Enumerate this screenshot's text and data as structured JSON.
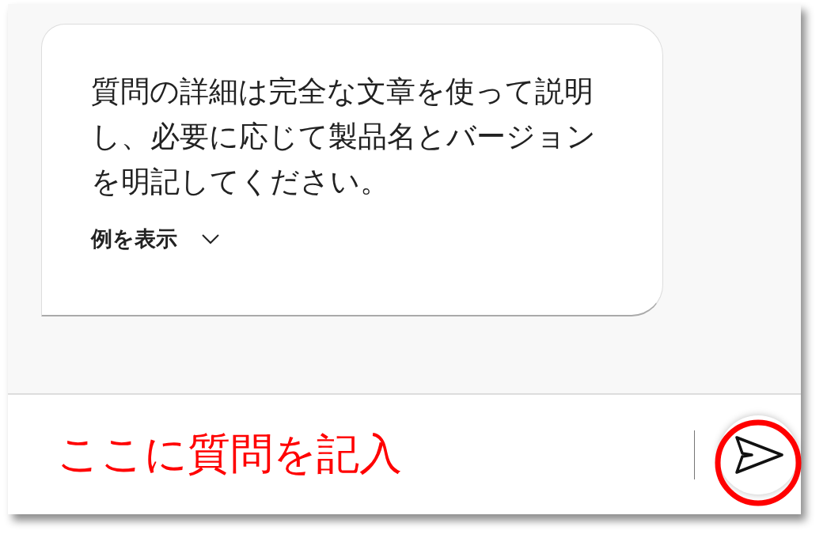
{
  "message": {
    "text": "質問の詳細は完全な文章を使って説明し、必要に応じて製品名とバージョンを明記してください。",
    "toggle": {
      "label": "例を表示",
      "expanded": false
    }
  },
  "composer": {
    "annotation": "ここに質問を記入"
  }
}
